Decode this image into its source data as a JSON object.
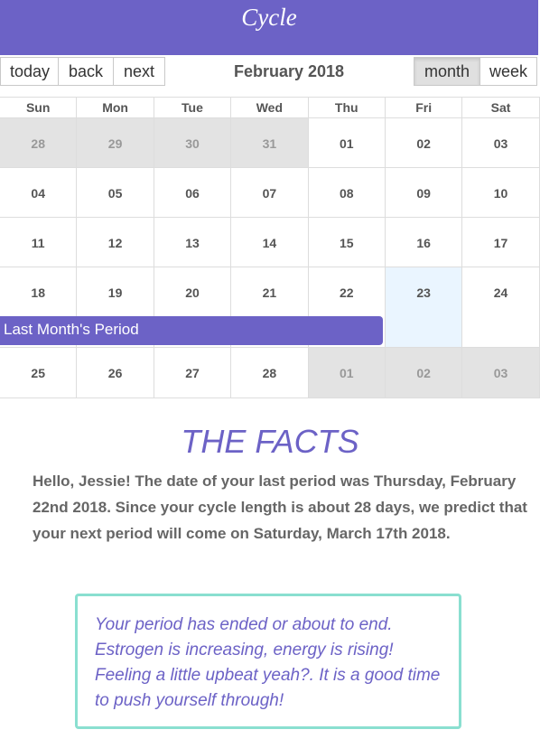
{
  "header": {
    "title": "Cycle"
  },
  "toolbar": {
    "today_label": "today",
    "back_label": "back",
    "next_label": "next",
    "month_title": "February 2018",
    "month_view_label": "month",
    "week_view_label": "week",
    "active_view": "month"
  },
  "calendar": {
    "weekdays": [
      "Sun",
      "Mon",
      "Tue",
      "Wed",
      "Thu",
      "Fri",
      "Sat"
    ],
    "weeks": [
      [
        "28",
        "29",
        "30",
        "31",
        "01",
        "02",
        "03"
      ],
      [
        "04",
        "05",
        "06",
        "07",
        "08",
        "09",
        "10"
      ],
      [
        "11",
        "12",
        "13",
        "14",
        "15",
        "16",
        "17"
      ],
      [
        "18",
        "19",
        "20",
        "21",
        "22",
        "23",
        "24"
      ],
      [
        "25",
        "26",
        "27",
        "28",
        "01",
        "02",
        "03"
      ]
    ],
    "event_label": "Last Month's Period",
    "colors": {
      "accent": "#6c62c6",
      "other_month": "#e3e3e3",
      "today": "#eaf5ff"
    }
  },
  "facts": {
    "heading": "THE FACTS",
    "text": "Hello, Jessie! The date of your last period was Thursday, February 22nd 2018. Since your cycle length is about 28 days, we predict that your next period will come on Saturday, March 17th 2018."
  },
  "advice": {
    "text": "Your period has ended or about to end. Estrogen is increasing, energy is rising! Feeling a little upbeat yeah?. It is a good time to push yourself through!",
    "border_color": "#8adfd0"
  }
}
